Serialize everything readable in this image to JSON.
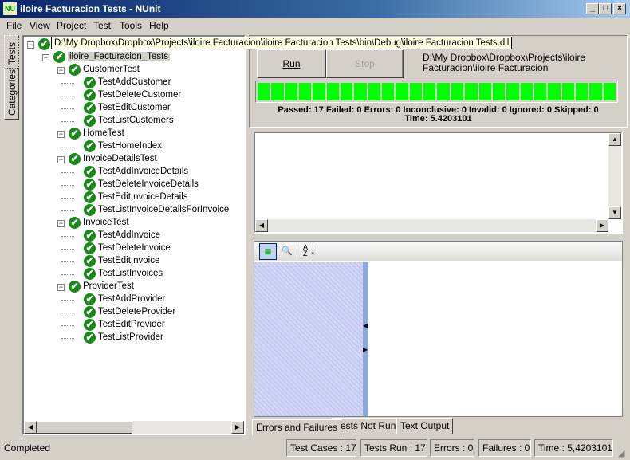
{
  "window": {
    "title": "iloire Facturacion Tests - NUnit",
    "logo": "NU",
    "minimize": "_",
    "maximize": "□",
    "close": "×"
  },
  "menu": [
    "File",
    "View",
    "Project",
    "Test",
    "Tools",
    "Help"
  ],
  "side_tabs": {
    "tests": "Tests",
    "categories": "Categories"
  },
  "tooltip": "D:\\My Dropbox\\Dropbox\\Projects\\iloire Facturacion\\iloire Facturacion Tests\\bin\\Debug\\iloire Facturacion Tests.dll",
  "tree": [
    {
      "label": "",
      "level": 0,
      "group": true
    },
    {
      "label": "iloire_Facturacion_Tests",
      "level": 1,
      "group": true,
      "selected": true
    },
    {
      "label": "CustomerTest",
      "level": 2,
      "group": true
    },
    {
      "label": "TestAddCustomer",
      "level": 3
    },
    {
      "label": "TestDeleteCustomer",
      "level": 3
    },
    {
      "label": "TestEditCustomer",
      "level": 3
    },
    {
      "label": "TestListCustomers",
      "level": 3
    },
    {
      "label": "HomeTest",
      "level": 2,
      "group": true
    },
    {
      "label": "TestHomeIndex",
      "level": 3
    },
    {
      "label": "InvoiceDetailsTest",
      "level": 2,
      "group": true
    },
    {
      "label": "TestAddInvoiceDetails",
      "level": 3
    },
    {
      "label": "TestDeleteInvoiceDetails",
      "level": 3
    },
    {
      "label": "TestEditInvoiceDetails",
      "level": 3
    },
    {
      "label": "TestListInvoiceDetailsForInvoice",
      "level": 3
    },
    {
      "label": "InvoiceTest",
      "level": 2,
      "group": true
    },
    {
      "label": "TestAddInvoice",
      "level": 3
    },
    {
      "label": "TestDeleteInvoice",
      "level": 3
    },
    {
      "label": "TestEditInvoice",
      "level": 3
    },
    {
      "label": "TestListInvoices",
      "level": 3
    },
    {
      "label": "ProviderTest",
      "level": 2,
      "group": true
    },
    {
      "label": "TestAddProvider",
      "level": 3
    },
    {
      "label": "TestDeleteProvider",
      "level": 3
    },
    {
      "label": "TestEditProvider",
      "level": 3
    },
    {
      "label": "TestListProvider",
      "level": 3
    }
  ],
  "run": {
    "run_label": "Run",
    "stop_label": "Stop",
    "path_line1": "D:\\My Dropbox\\Dropbox\\Projects\\iloire",
    "path_line2": "Facturacion\\iloire Facturacion",
    "progress_percent": 100,
    "progress_color": "#00ff00",
    "summary": "Passed: 17  Failed: 0  Errors: 0  Inconclusive: 0  Invalid: 0  Ignored: 0  Skipped: 0",
    "time": "Time: 5.4203101"
  },
  "result_tabs": [
    "Errors and Failures",
    "Tests Not Run",
    "Text Output"
  ],
  "status": {
    "text": "Completed",
    "test_cases": "Test Cases : 17",
    "tests_run": "Tests Run : 17",
    "errors": "Errors : 0",
    "failures": "Failures : 0",
    "time": "Time : 5,4203101"
  }
}
